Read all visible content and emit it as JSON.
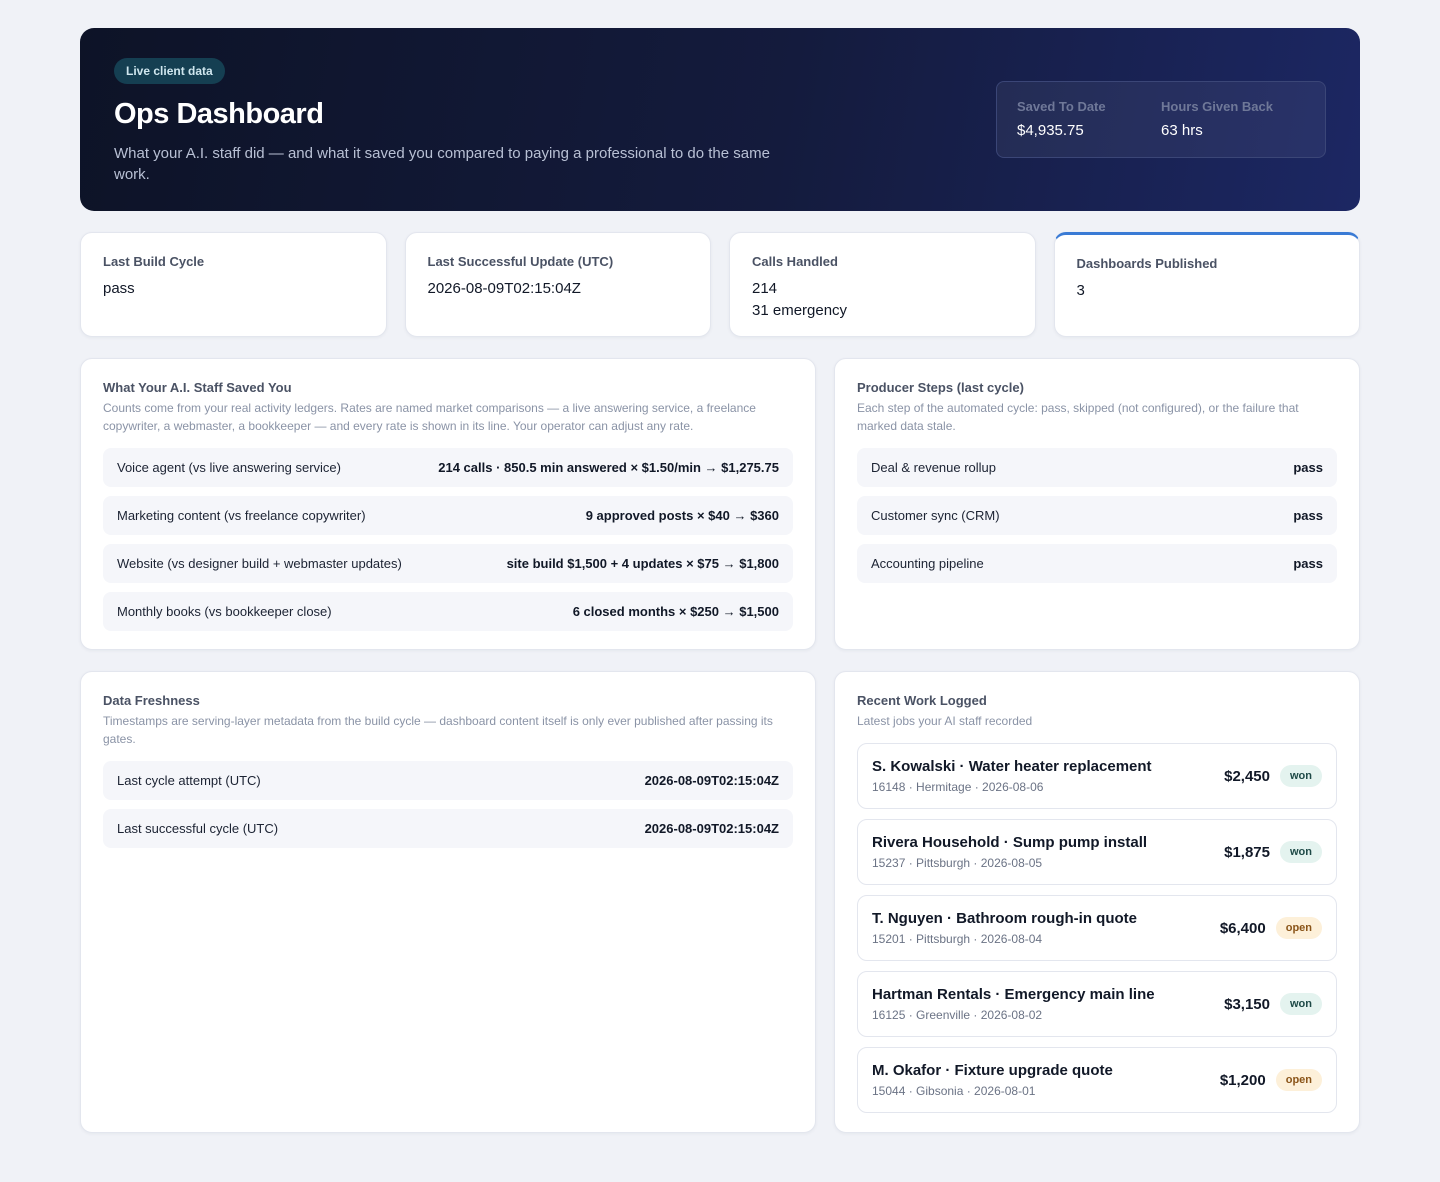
{
  "hero": {
    "badge": "Live client data",
    "title": "Ops Dashboard",
    "subtitle": "What your A.I. staff did — and what it saved you compared to paying a professional to do the same work.",
    "stats": [
      {
        "label": "Saved To Date",
        "value": "$4,935.75"
      },
      {
        "label": "Hours Given Back",
        "value": "63 hrs"
      }
    ]
  },
  "stat_cards": [
    {
      "label": "Last Build Cycle",
      "value": "pass",
      "value2": ""
    },
    {
      "label": "Last Successful Update (UTC)",
      "value": "2026-08-09T02:15:04Z",
      "value2": ""
    },
    {
      "label": "Calls Handled",
      "value": "214",
      "value2": "31 emergency"
    },
    {
      "label": "Dashboards Published",
      "value": "3",
      "value2": ""
    }
  ],
  "savings": {
    "title": "What Your A.I. Staff Saved You",
    "description": "Counts come from your real activity ledgers. Rates are named market comparisons — a live answering service, a freelance copywriter, a webmaster, a bookkeeper — and every rate is shown in its line. Your operator can adjust any rate.",
    "lines": [
      {
        "label": "Voice agent (vs live answering service)",
        "value": "214 calls · 850.5 min answered × $1.50/min → $1,275.75"
      },
      {
        "label": "Marketing content (vs freelance copywriter)",
        "value": "9 approved posts × $40 → $360"
      },
      {
        "label": "Website (vs designer build + webmaster updates)",
        "value": "site build $1,500 + 4 updates × $75 → $1,800"
      },
      {
        "label": "Monthly books (vs bookkeeper close)",
        "value": "6 closed months × $250 → $1,500"
      }
    ]
  },
  "producer": {
    "title": "Producer Steps (last cycle)",
    "description": "Each step of the automated cycle: pass, skipped (not configured), or the failure that marked data stale.",
    "steps": [
      {
        "label": "Deal & revenue rollup",
        "status": "pass"
      },
      {
        "label": "Customer sync (CRM)",
        "status": "pass"
      },
      {
        "label": "Accounting pipeline",
        "status": "pass"
      }
    ]
  },
  "freshness": {
    "title": "Data Freshness",
    "description": "Timestamps are serving-layer metadata from the build cycle — dashboard content itself is only ever published after passing its gates.",
    "lines": [
      {
        "label": "Last cycle attempt (UTC)",
        "value": "2026-08-09T02:15:04Z"
      },
      {
        "label": "Last successful cycle (UTC)",
        "value": "2026-08-09T02:15:04Z"
      }
    ]
  },
  "recent_work": {
    "title": "Recent Work Logged",
    "description": "Latest jobs your AI staff recorded",
    "jobs": [
      {
        "title": "S. Kowalski · Water heater replacement",
        "meta": "16148 · Hermitage · 2026-08-06",
        "amount": "$2,450",
        "status": "won"
      },
      {
        "title": "Rivera Household · Sump pump install",
        "meta": "15237 · Pittsburgh · 2026-08-05",
        "amount": "$1,875",
        "status": "won"
      },
      {
        "title": "T. Nguyen · Bathroom rough-in quote",
        "meta": "15201 · Pittsburgh · 2026-08-04",
        "amount": "$6,400",
        "status": "open"
      },
      {
        "title": "Hartman Rentals · Emergency main line",
        "meta": "16125 · Greenville · 2026-08-02",
        "amount": "$3,150",
        "status": "won"
      },
      {
        "title": "M. Okafor · Fixture upgrade quote",
        "meta": "15044 · Gibsonia · 2026-08-01",
        "amount": "$1,200",
        "status": "open"
      }
    ]
  },
  "colors": {
    "hero_start": "#0d1327",
    "hero_end": "#1c2763",
    "accent": "#3a7bd5",
    "won_bg": "#e4f3ef",
    "open_bg": "#fdf0d9"
  }
}
